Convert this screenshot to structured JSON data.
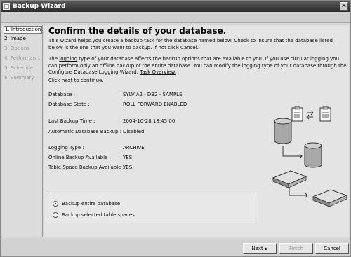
{
  "window": {
    "title": "Backup Wizard",
    "close_glyph": "✕"
  },
  "steps": [
    {
      "label": "1. Introduction",
      "state": "active"
    },
    {
      "label": "2. Image",
      "state": "current"
    },
    {
      "label": "3. Options",
      "state": "disabled"
    },
    {
      "label": "4. Performan...",
      "state": "disabled"
    },
    {
      "label": "5. Schedule",
      "state": "disabled"
    },
    {
      "label": "6. Summary",
      "state": "disabled"
    }
  ],
  "content": {
    "heading": "Confirm the details of your database.",
    "para1_before": "This wizard helps you create a ",
    "para1_link": "backup",
    "para1_after": " task for the database named below. Check to insure that the database listed below is the one that you want to backup. If not click Cancel.",
    "para2_before": "The ",
    "para2_link": "logging",
    "para2_after": " type of your database affects the backup options that are available to you. If you use circular logging you can perform only an offline backup of the entire database. You can modify the logging type of your database through the Configure Database Logging Wizard. ",
    "para2_link2": "Task Overview.",
    "para3": "Click next to continue."
  },
  "details": {
    "database_label": "Database :",
    "database_value": "SYLVIA2 - DB2 - SAMPLE",
    "state_label": "Database State :",
    "state_value": "ROLL FORWARD ENABLED",
    "last_backup_label": "Last Backup Time :",
    "last_backup_value": "2004-10-28 18:45:00",
    "auto_backup_label": "Automatic Database Backup :",
    "auto_backup_value": "Disabled",
    "logging_label": "Logging Type :",
    "logging_value": "ARCHIVE",
    "online_label": "Online Backup Available :",
    "online_value": "YES",
    "tablespace_label": "Table Space Backup Available :",
    "tablespace_value": "YES"
  },
  "backup_options": {
    "entire_label": "Backup entire database",
    "selected_label": "Backup selected table spaces",
    "selected": "entire"
  },
  "buttons": {
    "next": "Next",
    "next_arrow": "▶",
    "finish": "Finish",
    "cancel": "Cancel"
  }
}
